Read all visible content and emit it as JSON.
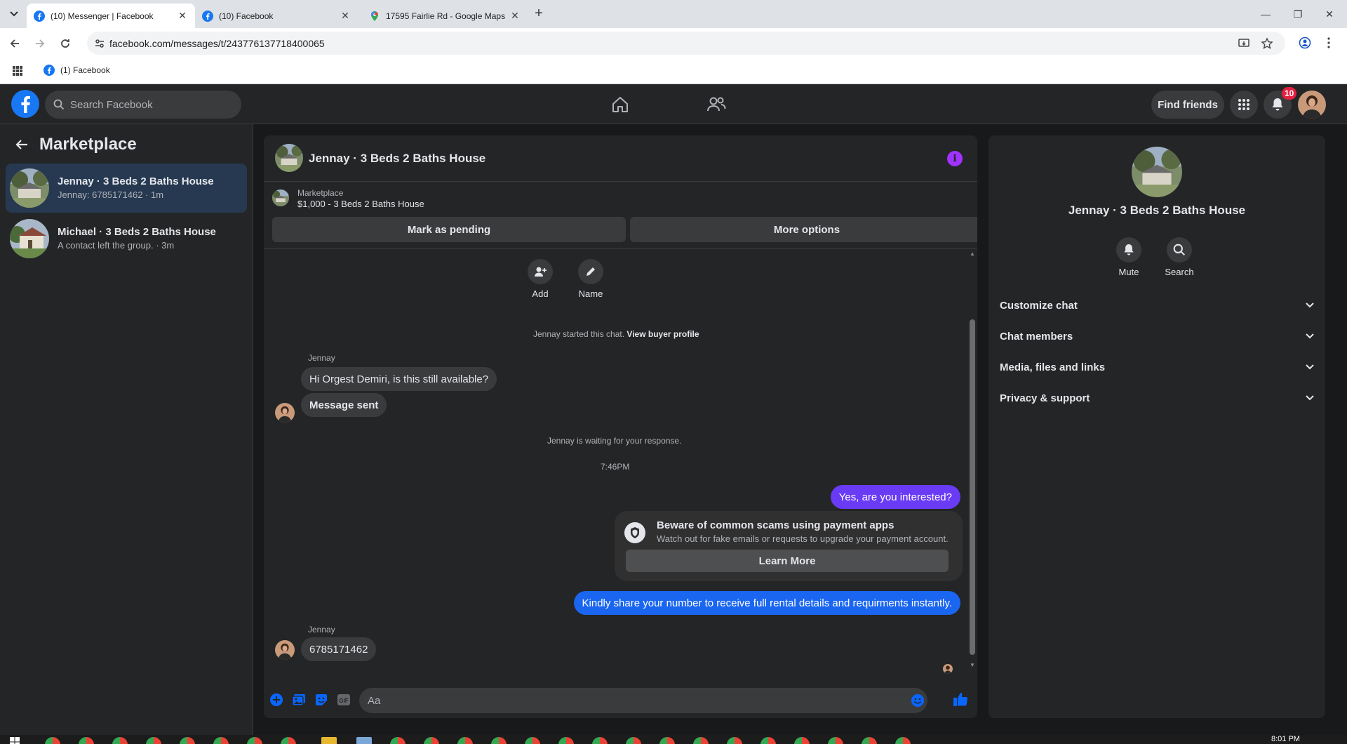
{
  "browser": {
    "tabs": [
      {
        "label": "(10) Messenger | Facebook",
        "active": true,
        "icon": "facebook-icon"
      },
      {
        "label": "(10) Facebook",
        "active": false,
        "icon": "facebook-icon"
      },
      {
        "label": "17595 Fairlie Rd - Google Maps",
        "active": false,
        "icon": "maps-pin-icon"
      }
    ],
    "url": "facebook.com/messages/t/243776137718400065",
    "bookmark": "(1) Facebook"
  },
  "fb": {
    "search_placeholder": "Search Facebook",
    "find_friends": "Find friends",
    "notification_count": "10",
    "brand_color": "#1877f2"
  },
  "sidebar": {
    "title": "Marketplace",
    "conversations": [
      {
        "title": "Jennay · 3 Beds 2 Baths House",
        "snippet": "Jennay: 6785171462 · 1m",
        "active": true
      },
      {
        "title": "Michael · 3 Beds 2 Baths House",
        "snippet": "A contact left the group. · 3m",
        "active": false
      }
    ]
  },
  "chat": {
    "title": "Jennay · 3 Beds 2 Baths House",
    "listing_source": "Marketplace",
    "listing": "$1,000 - 3 Beds 2 Baths House",
    "mark_pending": "Mark as pending",
    "more_options": "More options",
    "add_label": "Add",
    "name_label": "Name",
    "started_text": "Jennay started this chat.",
    "view_profile": "View buyer profile",
    "sender1": "Jennay",
    "msg1": "Hi Orgest Demiri, is this still available?",
    "msg2": "Message sent",
    "waiting": "Jennay is waiting for your response.",
    "time": "7:46PM",
    "out1": "Yes, are you interested?",
    "scam_title": "Beware of common scams using payment apps",
    "scam_desc": "Watch out for fake emails or requests to upgrade your payment account.",
    "learn_more": "Learn More",
    "out2": "Kindly share your number to receive full rental details and requirments instantly.",
    "sender2": "Jennay",
    "msg3": "6785171462",
    "composer_placeholder": "Aa",
    "accent_out1": "#6a3bf5",
    "accent_out2": "#1a66f0"
  },
  "rightpanel": {
    "name": "Jennay · 3 Beds 2 Baths House",
    "mute": "Mute",
    "search": "Search",
    "sections": [
      "Customize chat",
      "Chat members",
      "Media, files and links",
      "Privacy & support"
    ]
  },
  "taskbar": {
    "clock": "8:01 PM"
  }
}
